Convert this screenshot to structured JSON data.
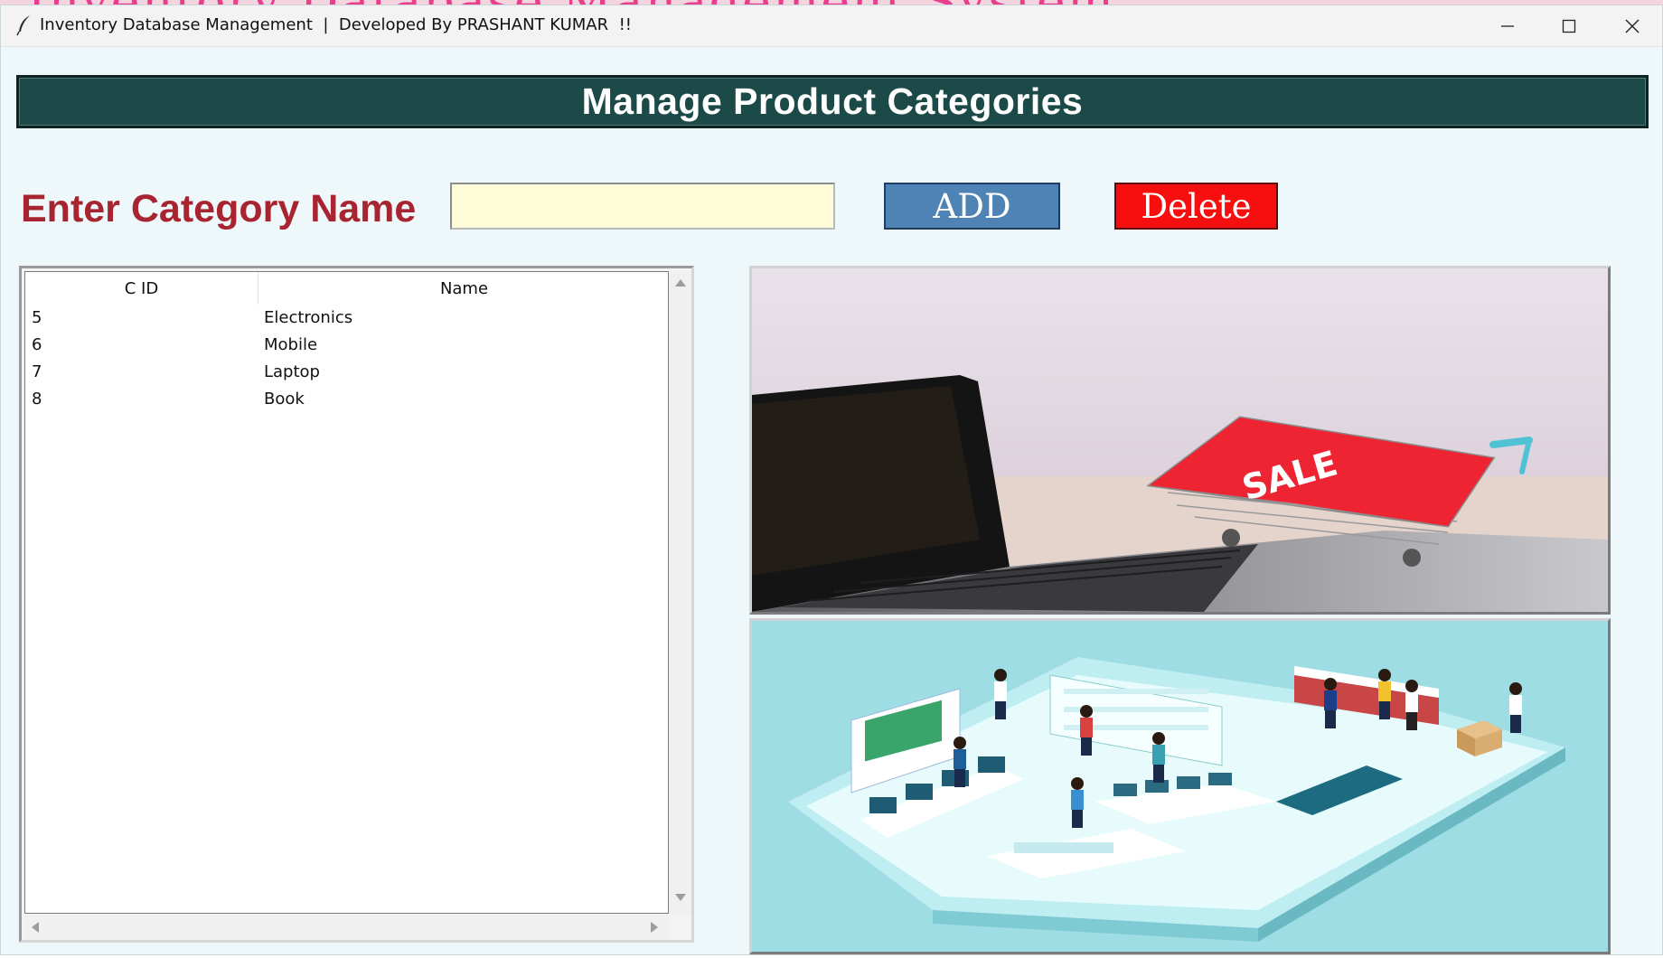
{
  "window": {
    "title": "Inventory Database Management  |  Developed By PRASHANT KUMAR  !!",
    "background_title_fragment": "Inventory Database Management System"
  },
  "header": {
    "title": "Manage Product Categories"
  },
  "form": {
    "label": "Enter Category Name",
    "input_value": "",
    "add_label": "ADD",
    "delete_label": "Delete"
  },
  "table": {
    "columns": [
      "C ID",
      "Name"
    ],
    "rows": [
      {
        "cid": "5",
        "name": "Electronics"
      },
      {
        "cid": "6",
        "name": "Mobile"
      },
      {
        "cid": "7",
        "name": "Laptop"
      },
      {
        "cid": "8",
        "name": "Book"
      }
    ]
  },
  "images": {
    "sale_banner_text": "SALE"
  },
  "colors": {
    "header_bg": "#1b4a48",
    "label_red": "#a82430",
    "input_bg": "#fefbd8",
    "add_blue": "#4f82b5",
    "delete_red": "#f70e0e",
    "window_bg": "#eef8fa"
  },
  "icons": [
    "feather-app-icon",
    "minimize-icon",
    "maximize-icon",
    "close-icon"
  ]
}
